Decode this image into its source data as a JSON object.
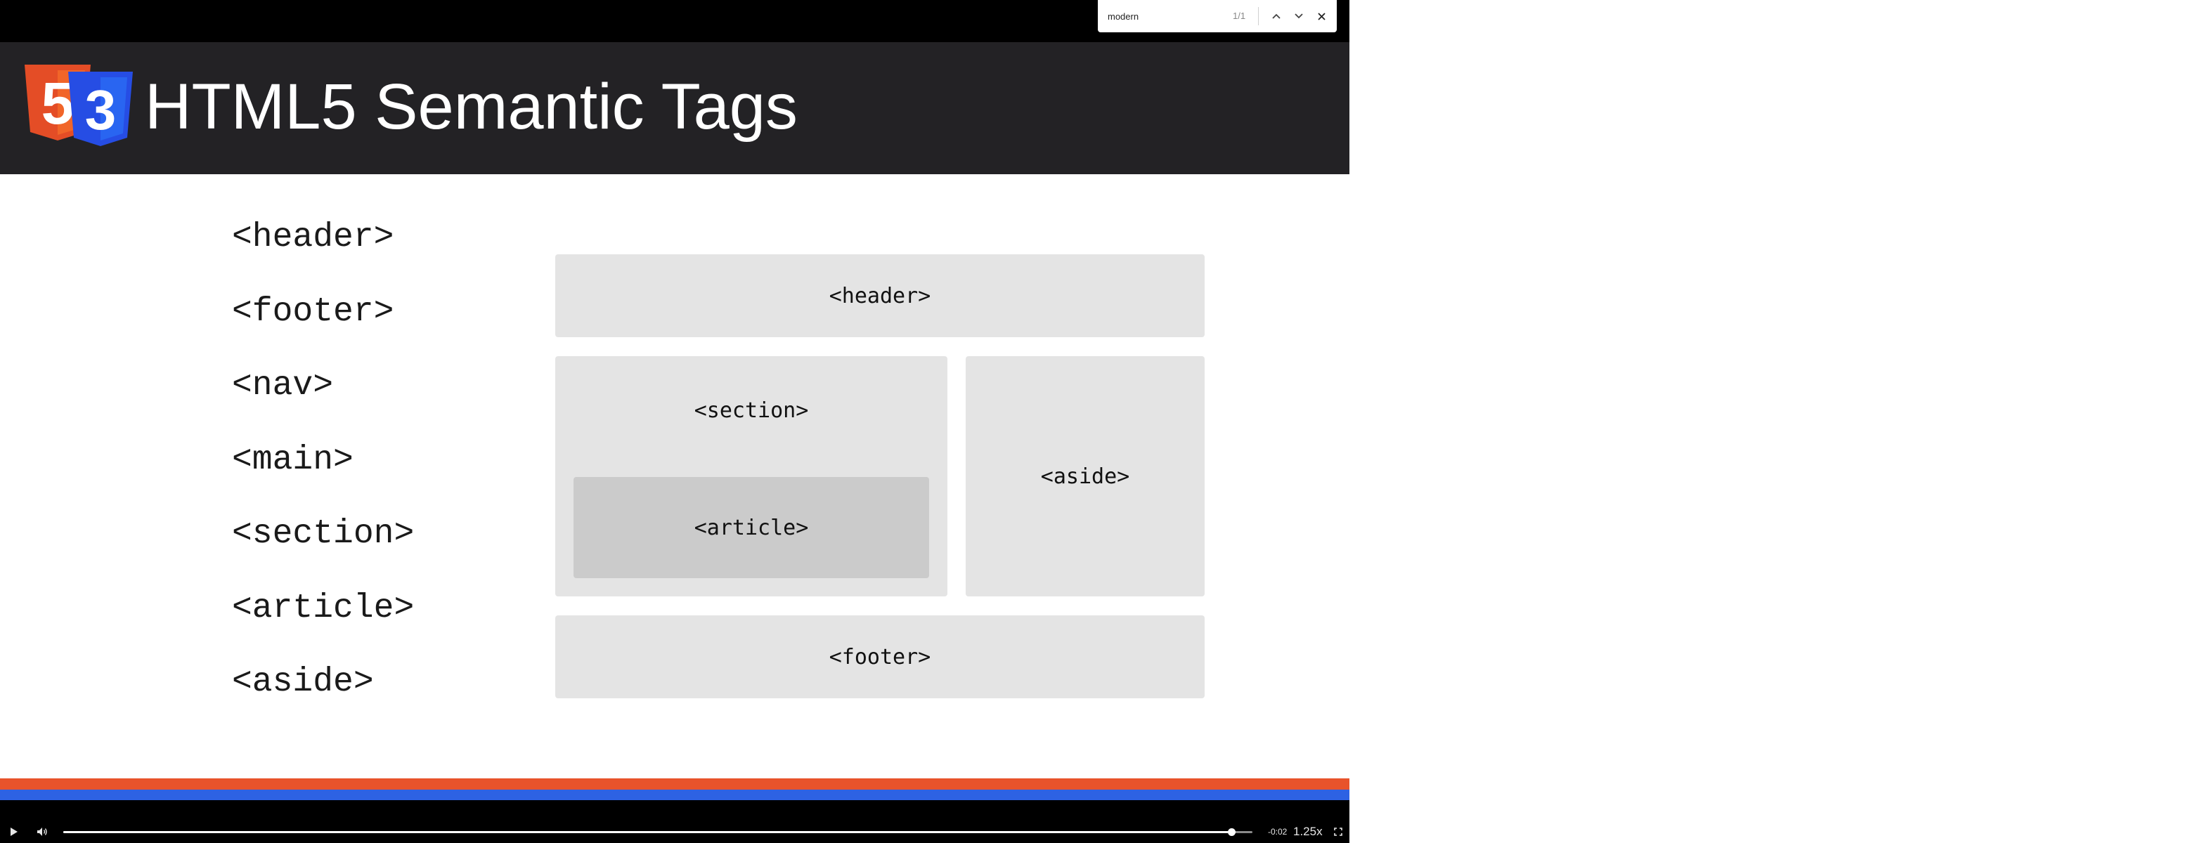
{
  "slide": {
    "title": "HTML5 Semantic Tags",
    "tags": [
      "<header>",
      "<footer>",
      "<nav>",
      "<main>",
      "<section>",
      "<article>",
      "<aside>"
    ],
    "layout_boxes": {
      "header": "<header>",
      "section": "<section>",
      "article": "<article>",
      "aside": "<aside>",
      "footer": "<footer>"
    },
    "logo": {
      "html5_digit": "5",
      "css3_digit": "3",
      "html5_color": "#e44d26",
      "css3_color": "#264de4"
    }
  },
  "player": {
    "time_remaining": "-0:02",
    "speed": "1.25x",
    "progress": 0.9824,
    "play_icon": "play-icon",
    "volume_icon": "volume-icon",
    "fullscreen_icon": "fullscreen-icon"
  },
  "find_bar": {
    "query": "modern",
    "match_count": "1/1"
  },
  "colors": {
    "header_bg": "#232225",
    "stripe_orange": "#e8532b",
    "stripe_blue": "#2d62e3",
    "box_bg": "#e4e4e4",
    "article_bg": "#cbcbcb"
  }
}
